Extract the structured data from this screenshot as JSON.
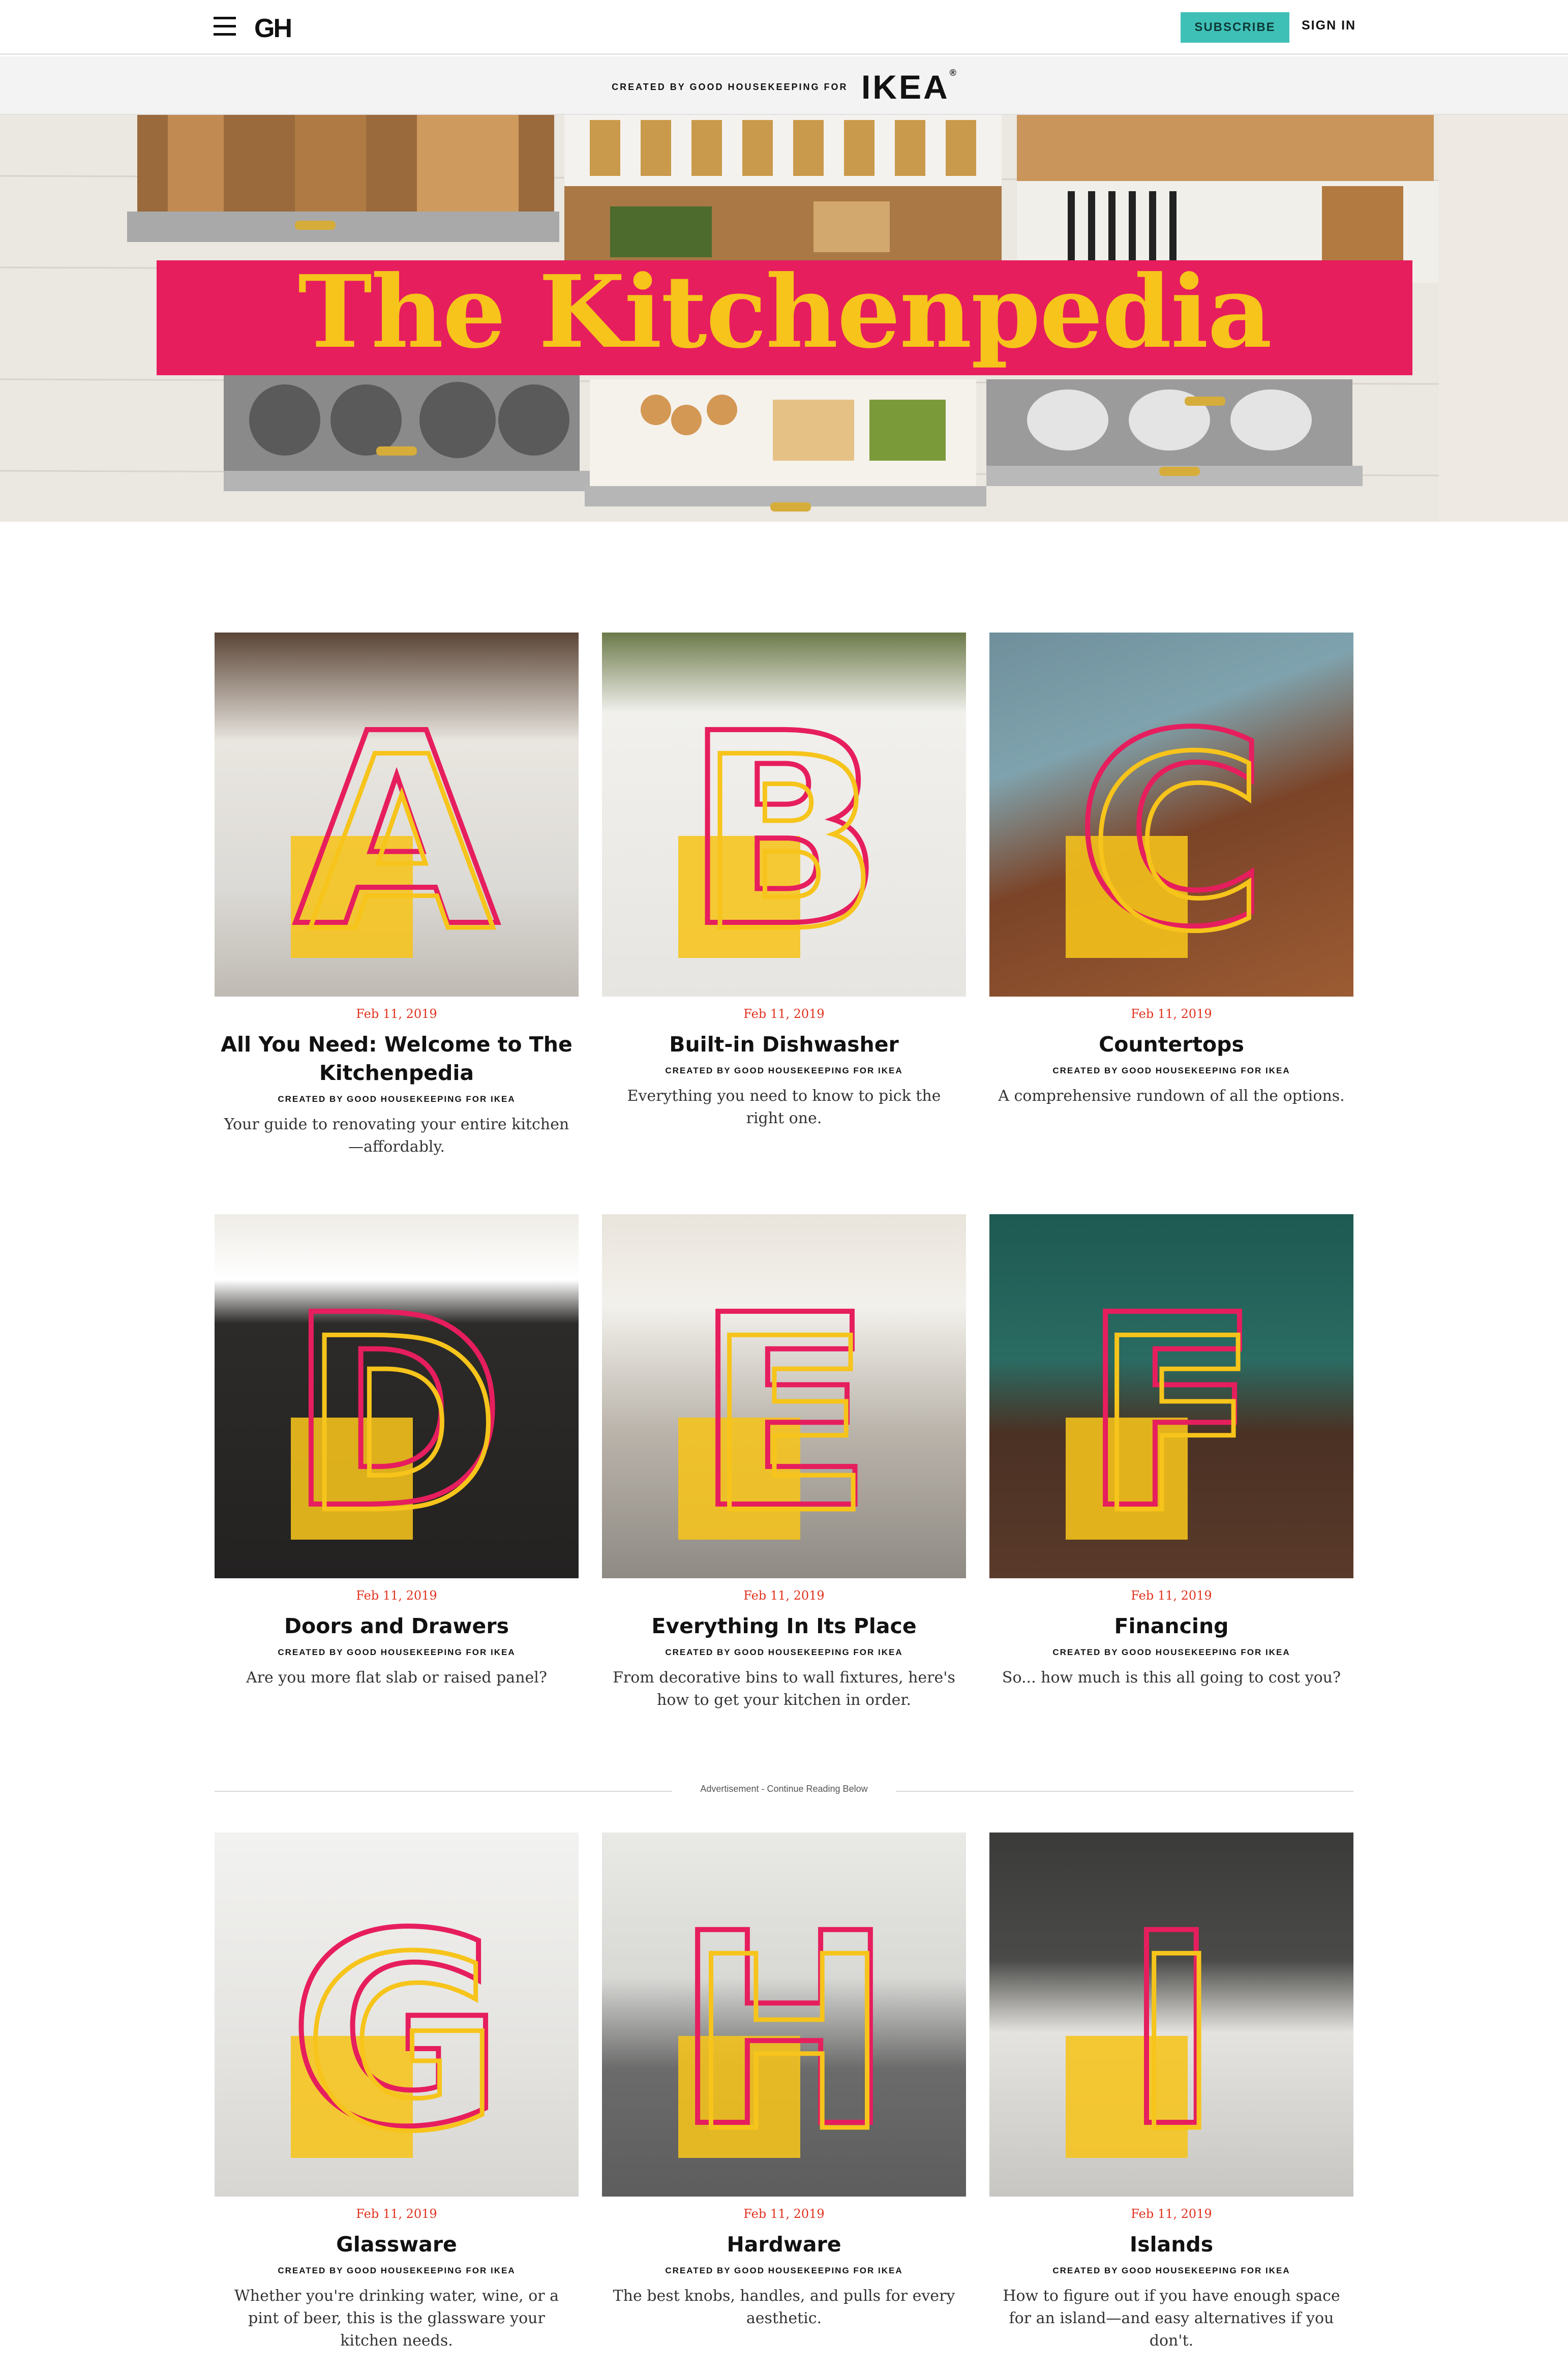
{
  "nav": {
    "logo": "GH",
    "subscribe_label": "SUBSCRIBE",
    "signin_label": "SIGN IN"
  },
  "sponsor": {
    "text": "CREATED BY GOOD HOUSEKEEPING FOR",
    "brand": "IKEA",
    "brand_mark": "®"
  },
  "hero": {
    "title": "The Kitchenpedia",
    "banner_color": "#e61e5e",
    "title_color": "#f6c41b"
  },
  "colors": {
    "accent_pink": "#e61e5e",
    "accent_yellow": "#f6c41b",
    "date_red": "#e2321e",
    "subscribe_teal": "#3fc0b7"
  },
  "ad_label": "Advertisement - Continue Reading Below",
  "articles": [
    {
      "letter": "A",
      "date": "Feb 11, 2019",
      "title": "All You Need: Welcome to The Kitchenpedia",
      "byline": "CREATED BY GOOD HOUSEKEEPING FOR IKEA",
      "dek": "Your guide to renovating your entire kitchen—affordably."
    },
    {
      "letter": "B",
      "date": "Feb 11, 2019",
      "title": "Built-in Dishwasher",
      "byline": "CREATED BY GOOD HOUSEKEEPING FOR IKEA",
      "dek": "Everything you need to know to pick the right one."
    },
    {
      "letter": "C",
      "date": "Feb 11, 2019",
      "title": "Countertops",
      "byline": "CREATED BY GOOD HOUSEKEEPING FOR IKEA",
      "dek": "A comprehensive rundown of all the options."
    },
    {
      "letter": "D",
      "date": "Feb 11, 2019",
      "title": "Doors and Drawers",
      "byline": "CREATED BY GOOD HOUSEKEEPING FOR IKEA",
      "dek": "Are you more flat slab or raised panel?"
    },
    {
      "letter": "E",
      "date": "Feb 11, 2019",
      "title": "Everything In Its Place",
      "byline": "CREATED BY GOOD HOUSEKEEPING FOR IKEA",
      "dek": "From decorative bins to wall fixtures, here's how to get your kitchen in order."
    },
    {
      "letter": "F",
      "date": "Feb 11, 2019",
      "title": "Financing",
      "byline": "CREATED BY GOOD HOUSEKEEPING FOR IKEA",
      "dek": "So... how much is this all going to cost you?"
    },
    {
      "letter": "G",
      "date": "Feb 11, 2019",
      "title": "Glassware",
      "byline": "CREATED BY GOOD HOUSEKEEPING FOR IKEA",
      "dek": "Whether you're drinking water, wine, or a pint of beer, this is the glassware your kitchen needs."
    },
    {
      "letter": "H",
      "date": "Feb 11, 2019",
      "title": "Hardware",
      "byline": "CREATED BY GOOD HOUSEKEEPING FOR IKEA",
      "dek": "The best knobs, handles, and pulls for every aesthetic."
    },
    {
      "letter": "I",
      "date": "Feb 11, 2019",
      "title": "Islands",
      "byline": "CREATED BY GOOD HOUSEKEEPING FOR IKEA",
      "dek": "How to figure out if you have enough space for an island—and easy alternatives if you don't."
    }
  ]
}
